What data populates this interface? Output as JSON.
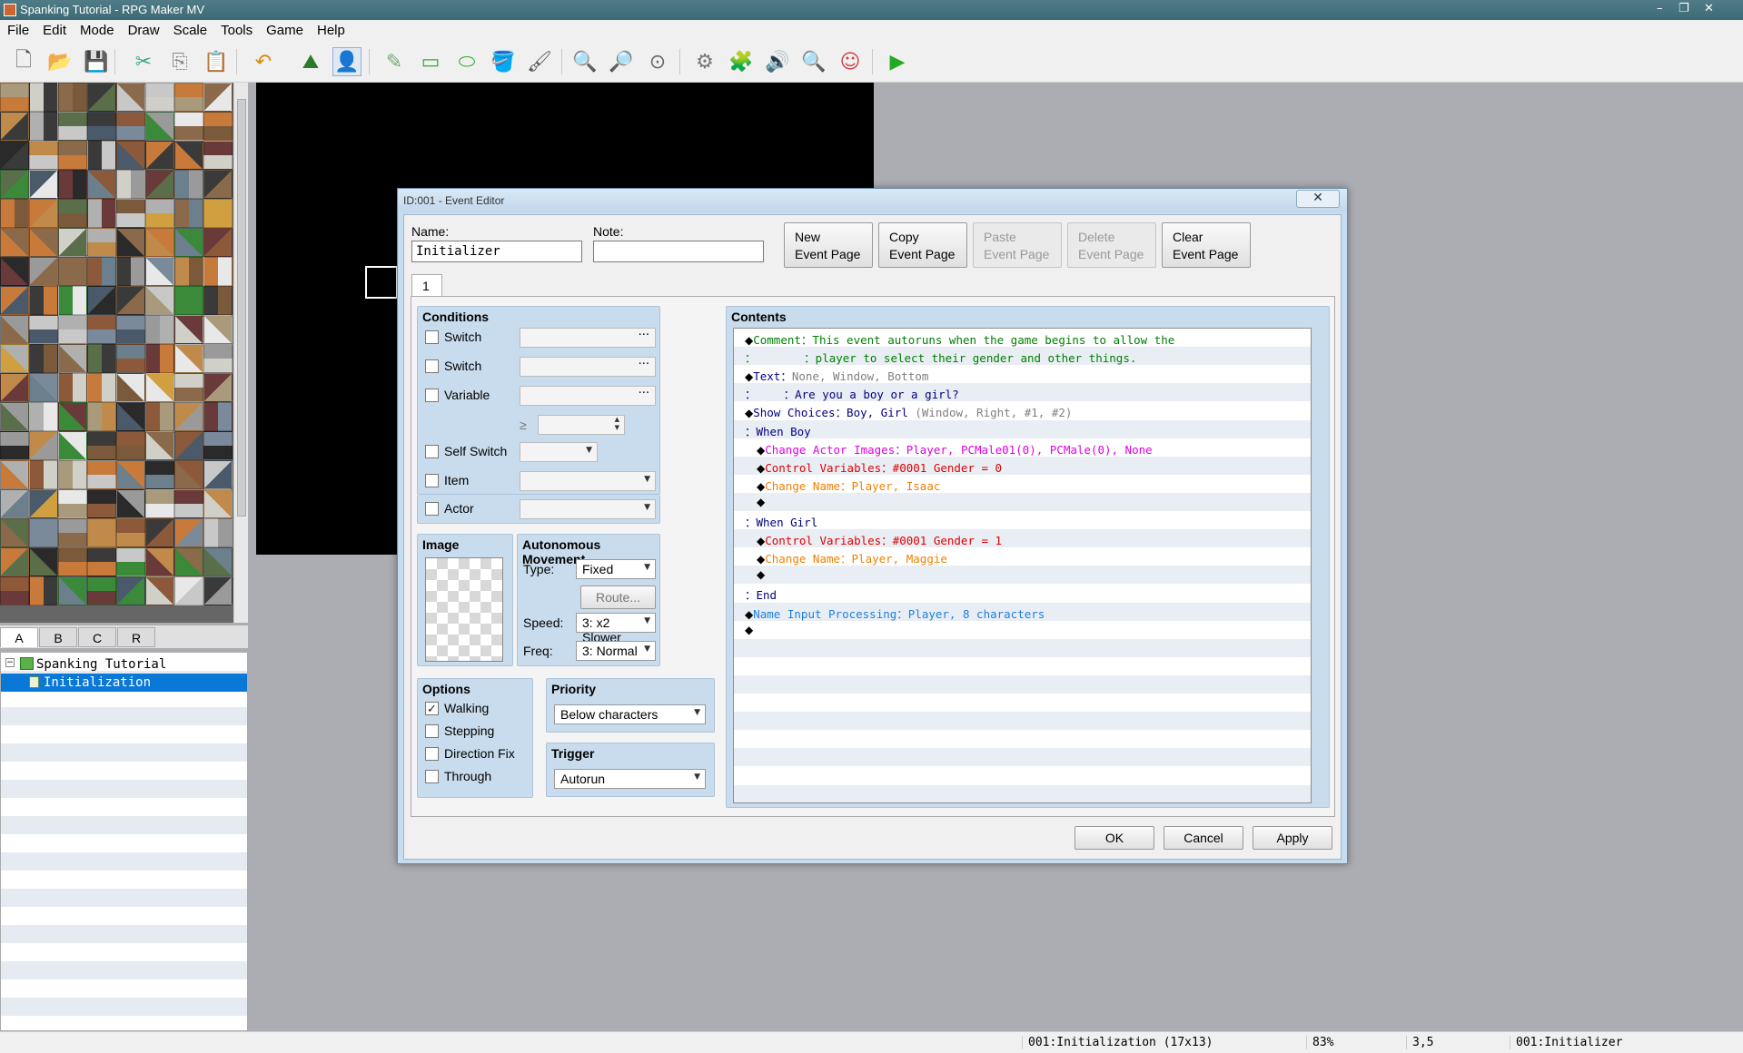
{
  "window": {
    "title": "Spanking Tutorial - RPG Maker MV",
    "min": "–",
    "restore": "❐",
    "close": "✕"
  },
  "menu": [
    "File",
    "Edit",
    "Mode",
    "Draw",
    "Scale",
    "Tools",
    "Game",
    "Help"
  ],
  "toolbar": [
    {
      "name": "new-project-icon",
      "glyph": "🗋"
    },
    {
      "name": "open-project-icon",
      "glyph": "📂"
    },
    {
      "name": "save-project-icon",
      "glyph": "💾"
    },
    {
      "name": "cut-icon",
      "glyph": "✂"
    },
    {
      "name": "copy-icon",
      "glyph": "⎘"
    },
    {
      "name": "paste-icon",
      "glyph": "📋"
    },
    {
      "name": "undo-icon",
      "glyph": "↶"
    },
    {
      "name": "map-mode-icon",
      "glyph": "⛰"
    },
    {
      "name": "event-mode-icon",
      "glyph": "👤"
    },
    {
      "name": "pencil-icon",
      "glyph": "✎"
    },
    {
      "name": "rectangle-icon",
      "glyph": "▭"
    },
    {
      "name": "ellipse-icon",
      "glyph": "⬭"
    },
    {
      "name": "flood-fill-icon",
      "glyph": "🪣"
    },
    {
      "name": "shadow-pen-icon",
      "glyph": "🖌"
    },
    {
      "name": "zoom-in-icon",
      "glyph": "🔍"
    },
    {
      "name": "zoom-out-icon",
      "glyph": "🔎"
    },
    {
      "name": "actual-size-icon",
      "glyph": "⊙"
    },
    {
      "name": "database-icon",
      "glyph": "⚙"
    },
    {
      "name": "plugin-manager-icon",
      "glyph": "🧩"
    },
    {
      "name": "sound-test-icon",
      "glyph": "🔊"
    },
    {
      "name": "event-searcher-icon",
      "glyph": "🔍"
    },
    {
      "name": "character-generator-icon",
      "glyph": "☺"
    },
    {
      "name": "playtest-icon",
      "glyph": "▶"
    }
  ],
  "tileset_tabs": [
    "A",
    "B",
    "C",
    "R"
  ],
  "map_tree": {
    "project": "Spanking Tutorial",
    "map": "Initialization"
  },
  "status": {
    "map": "001:Initialization (17x13)",
    "zoom": "83%",
    "coords": "3,5",
    "event": "001:Initializer"
  },
  "dialog": {
    "title": "ID:001 - Event Editor",
    "close": "✕",
    "name_label": "Name:",
    "name_value": "Initializer",
    "note_label": "Note:",
    "note_value": "",
    "page_buttons": [
      {
        "l1": "New",
        "l2": "Event Page",
        "enabled": true
      },
      {
        "l1": "Copy",
        "l2": "Event Page",
        "enabled": true
      },
      {
        "l1": "Paste",
        "l2": "Event Page",
        "enabled": false
      },
      {
        "l1": "Delete",
        "l2": "Event Page",
        "enabled": false
      },
      {
        "l1": "Clear",
        "l2": "Event Page",
        "enabled": true
      }
    ],
    "page_tab": "1",
    "conditions": {
      "title": "Conditions",
      "switch1": "Switch",
      "switch2": "Switch",
      "variable": "Variable",
      "gte": "≥",
      "self_switch": "Self Switch",
      "item": "Item",
      "actor": "Actor",
      "dots": "···"
    },
    "image": {
      "title": "Image"
    },
    "autonomous": {
      "title": "Autonomous Movement",
      "type_label": "Type:",
      "type_value": "Fixed",
      "route": "Route...",
      "speed_label": "Speed:",
      "speed_value": "3: x2 Slower",
      "freq_label": "Freq:",
      "freq_value": "3: Normal"
    },
    "options": {
      "title": "Options",
      "walking": "Walking",
      "walking_checked": true,
      "stepping": "Stepping",
      "direction_fix": "Direction Fix",
      "through": "Through",
      "check": "✓"
    },
    "priority": {
      "title": "Priority",
      "value": "Below characters"
    },
    "trigger": {
      "title": "Trigger",
      "value": "Autorun"
    },
    "contents_title": "Contents",
    "contents": [
      {
        "indent": 0,
        "diamond": true,
        "parts": [
          [
            "Comment",
            "#008000"
          ],
          [
            "：This event autoruns when the game begins to allow the",
            "#008000"
          ]
        ]
      },
      {
        "indent": 0,
        "diamond": false,
        "parts": [
          [
            "：       ：player to select their gender and other things.",
            "#008000"
          ]
        ]
      },
      {
        "indent": 0,
        "diamond": true,
        "parts": [
          [
            "Text",
            "#000080"
          ],
          [
            "：",
            "#000080"
          ],
          [
            "None, Window, Bottom",
            "#808080"
          ]
        ]
      },
      {
        "indent": 0,
        "diamond": false,
        "parts": [
          [
            "：    ：Are you a boy or a girl?",
            "#000080"
          ]
        ]
      },
      {
        "indent": 0,
        "diamond": true,
        "parts": [
          [
            "Show Choices",
            "#000080"
          ],
          [
            "：Boy, Girl ",
            "#000080"
          ],
          [
            "(Window, Right, #1, #2)",
            "#808080"
          ]
        ]
      },
      {
        "indent": 0,
        "diamond": false,
        "parts": [
          [
            "：When Boy",
            "#000080"
          ]
        ]
      },
      {
        "indent": 1,
        "diamond": true,
        "parts": [
          [
            "Change Actor Images",
            "#e000e0"
          ],
          [
            "：Player, PCMale01(0), PCMale(0), None",
            "#e000e0"
          ]
        ]
      },
      {
        "indent": 1,
        "diamond": true,
        "parts": [
          [
            "Control Variables",
            "#e00000"
          ],
          [
            "：#0001 Gender = 0",
            "#e00000"
          ]
        ]
      },
      {
        "indent": 1,
        "diamond": true,
        "parts": [
          [
            "Change Name",
            "#f08000"
          ],
          [
            "：Player, Isaac",
            "#f08000"
          ]
        ]
      },
      {
        "indent": 1,
        "diamond": true,
        "parts": []
      },
      {
        "indent": 0,
        "diamond": false,
        "parts": [
          [
            "：When Girl",
            "#000080"
          ]
        ]
      },
      {
        "indent": 1,
        "diamond": true,
        "parts": [
          [
            "Control Variables",
            "#e00000"
          ],
          [
            "：#0001 Gender = 1",
            "#e00000"
          ]
        ]
      },
      {
        "indent": 1,
        "diamond": true,
        "parts": [
          [
            "Change Name",
            "#f08000"
          ],
          [
            "：Player, Maggie",
            "#f08000"
          ]
        ]
      },
      {
        "indent": 1,
        "diamond": true,
        "parts": []
      },
      {
        "indent": 0,
        "diamond": false,
        "parts": [
          [
            "：End",
            "#000080"
          ]
        ]
      },
      {
        "indent": 0,
        "diamond": true,
        "parts": [
          [
            "Name Input Processing",
            "#2080e0"
          ],
          [
            "：Player, 8 characters",
            "#2080e0"
          ]
        ]
      },
      {
        "indent": 0,
        "diamond": true,
        "parts": []
      }
    ],
    "ok": "OK",
    "cancel": "Cancel",
    "apply": "Apply"
  }
}
